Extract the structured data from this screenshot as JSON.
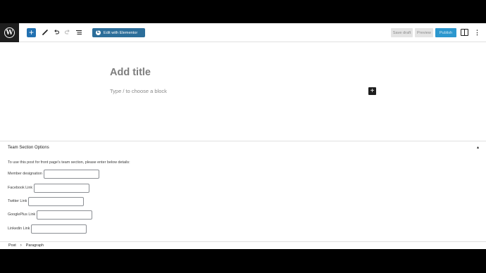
{
  "toolbar": {
    "add_icon": "plus-icon",
    "edit_elementor_label": "Edit with Elementor",
    "save_draft_label": "Save draft",
    "preview_label": "Preview",
    "publish_label": "Publish",
    "colors": {
      "primary": "#2271b1",
      "elementor": "#2c6e9a",
      "publish": "#2c97ce"
    }
  },
  "editor": {
    "title_placeholder": "Add title",
    "block_placeholder": "Type / to choose a block"
  },
  "metabox": {
    "title": "Team Section Options",
    "intro": "To use this post for front page's team section, please enter below details:",
    "fields": [
      {
        "label": "Member designation",
        "value": ""
      },
      {
        "label": "Facebook Link",
        "value": ""
      },
      {
        "label": "Twitter Link",
        "value": ""
      },
      {
        "label": "GooglePlus Link",
        "value": ""
      },
      {
        "label": "Linkedin Link",
        "value": ""
      }
    ]
  },
  "breadcrumb": {
    "items": [
      "Post",
      "Paragraph"
    ]
  }
}
